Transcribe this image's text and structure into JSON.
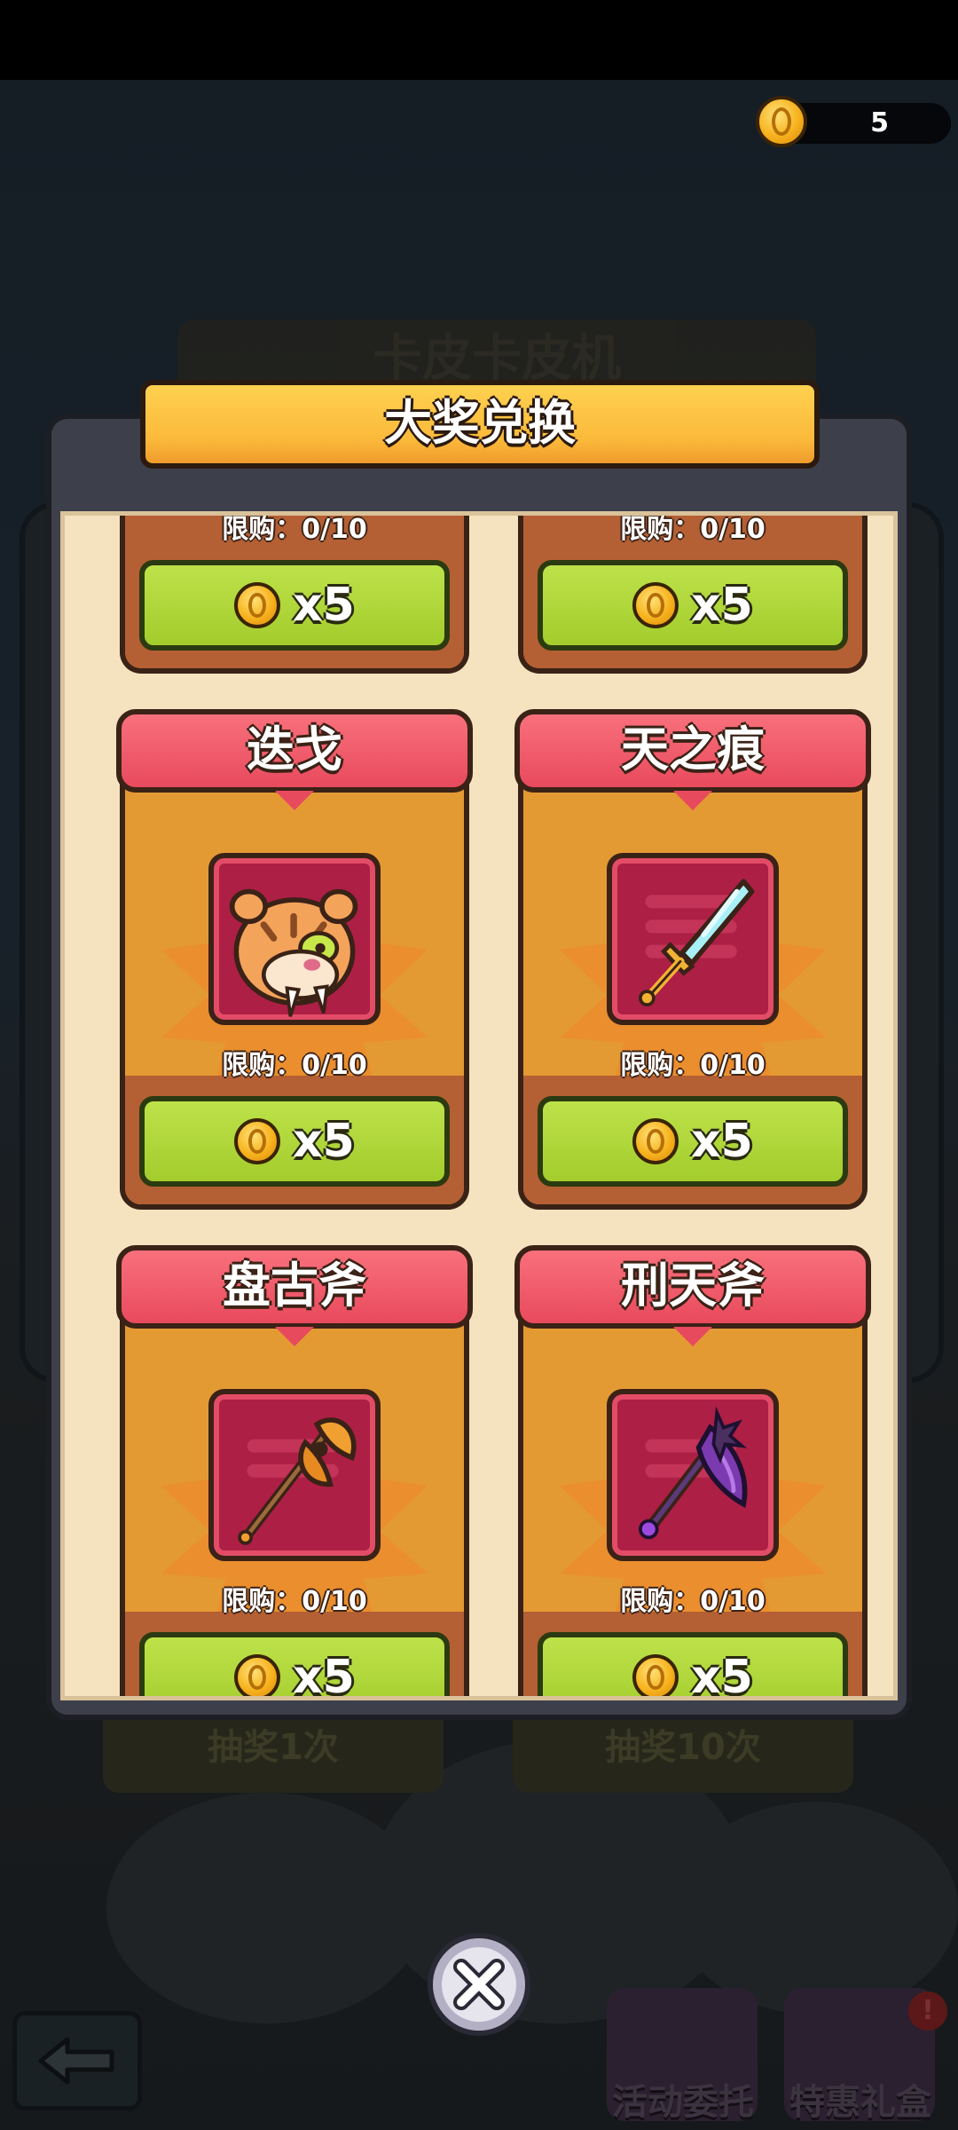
{
  "wallet": {
    "coin_count": "5"
  },
  "background": {
    "machine_title": "卡皮卡皮机",
    "draw_once_label": "抽奖1次",
    "draw_ten_label": "抽奖10次",
    "tasks_label": "活动委托",
    "giftbox_label": "特惠礼盒",
    "badge": "!"
  },
  "dialog": {
    "title": "大奖兑换",
    "cards": [
      {
        "name": "",
        "limit": "限购：0/10",
        "price": "x5",
        "icon": "partial"
      },
      {
        "name": "",
        "limit": "限购：0/10",
        "price": "x5",
        "icon": "partial"
      },
      {
        "name": "迭戈",
        "limit": "限购：0/10",
        "price": "x5",
        "icon": "sabertooth-tiger-icon"
      },
      {
        "name": "天之痕",
        "limit": "限购：0/10",
        "price": "x5",
        "icon": "crystal-sword-icon"
      },
      {
        "name": "盘古斧",
        "limit": "限购：0/10",
        "price": "x5",
        "icon": "golden-axe-icon"
      },
      {
        "name": "刑天斧",
        "limit": "限购：0/10",
        "price": "x5",
        "icon": "dark-axe-icon"
      }
    ]
  },
  "colors": {
    "card_orange": "#e49a33",
    "header_red": "#e84a5d",
    "button_green": "#a3cc2c",
    "ribbon_yellow": "#fbb93a",
    "panel_cream": "#f5e3c0"
  }
}
